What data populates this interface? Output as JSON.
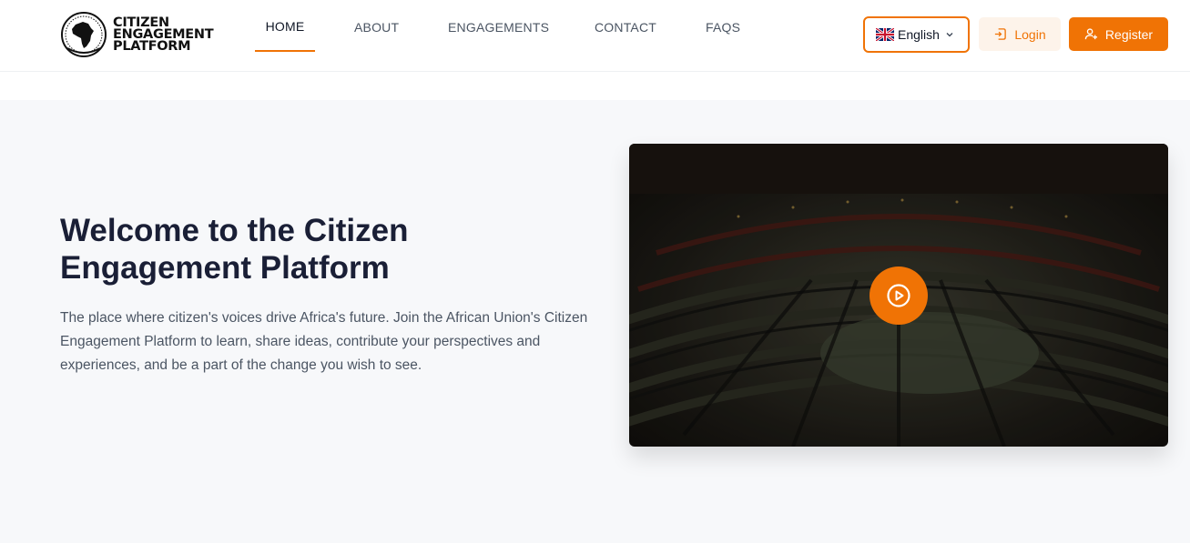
{
  "logo": {
    "icon": "african-union-emblem",
    "lines": [
      "CITIZEN",
      "ENGAGEMENT",
      "PLATFORM"
    ]
  },
  "nav": {
    "items": [
      {
        "label": "HOME",
        "active": true
      },
      {
        "label": "ABOUT",
        "active": false
      },
      {
        "label": "ENGAGEMENTS",
        "active": false
      },
      {
        "label": "CONTACT",
        "active": false
      },
      {
        "label": "FAQS",
        "active": false
      }
    ]
  },
  "language": {
    "selected": "English",
    "icon": "uk-flag-icon"
  },
  "auth": {
    "login_label": "Login",
    "register_label": "Register"
  },
  "hero": {
    "title": "Welcome to the Citizen Engagement Platform",
    "description": "The place where citizen's voices drive Africa's future. Join the African Union's Citizen Engagement Platform to learn, share ideas, contribute your perspectives and experiences, and be a part of the change you wish to see.",
    "video_icon": "play-icon"
  },
  "colors": {
    "accent": "#f07305",
    "accent_light": "#fdf3ea",
    "hero_bg": "#f7f8fa",
    "heading": "#1a1f36"
  }
}
